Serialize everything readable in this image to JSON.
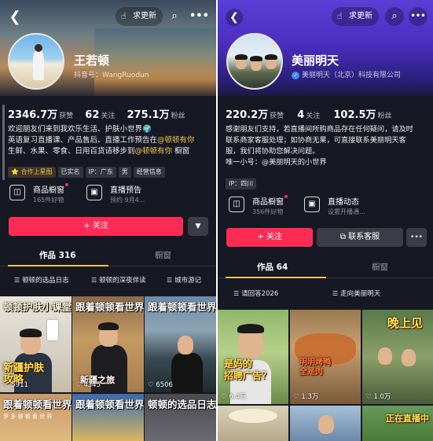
{
  "left": {
    "more_button": "求更新",
    "name": "王若顿",
    "account_id": "抖音号：WangRuodun",
    "stats": [
      {
        "value": "2346.7万",
        "label": "获赞"
      },
      {
        "value": "62",
        "label": "关注"
      },
      {
        "value": "275.1万",
        "label": "粉丝"
      }
    ],
    "bio": {
      "line1": "欢迎朋友们来到我欢乐生活、护肤小世界🌍",
      "line2a": "英语复习直播课、产品售后、直播工作预告在",
      "line2b": "@顿顿有你",
      "line3a": "生鲜、水果、零食、日用百货请移步到",
      "line3b": "@顿顿有你",
      "line3c": "橱窗"
    },
    "tags": [
      "合作上星图",
      "已实名",
      "IP：广东",
      "男",
      "settings-tag"
    ],
    "tag_labels": [
      "⭐ 合作上星图",
      "已实名",
      "IP：广东",
      "男",
      "经营信息"
    ],
    "features": [
      {
        "title": "商品橱窗",
        "sub": "165件好物"
      },
      {
        "title": "直播预告",
        "sub": "预约 9月4..."
      }
    ],
    "follow_button": "+ 关注",
    "tabs": [
      "作品 316",
      "橱窗"
    ],
    "chips": [
      "顿顿的选品日志",
      "顿顿的深夜伴读",
      "城市游记"
    ],
    "tiles": [
      {
        "title": "顿顿护肤小课堂",
        "big": "新疆护肤\n攻略",
        "count": "5911"
      },
      {
        "title": "跟着顿顿看世界",
        "big": "新疆之旅",
        "count": "4345"
      },
      {
        "title": "跟着顿顿看世界",
        "big": "",
        "count": "6506"
      },
      {
        "title": "跟着顿顿看世界",
        "big": "",
        "count": ""
      },
      {
        "title": "跟着顿顿看世界",
        "big": "",
        "count": ""
      },
      {
        "title": "顿顿的选品日志",
        "big": "",
        "count": ""
      }
    ]
  },
  "right": {
    "more_button": "求更新",
    "name": "美丽明天",
    "company": "美丽明天（北京）科技有限公司",
    "stats": [
      {
        "value": "220.2万",
        "label": "获赞"
      },
      {
        "value": "4",
        "label": "关注"
      },
      {
        "value": "102.5万",
        "label": "粉丝"
      }
    ],
    "bio": {
      "line1": "感谢朋友们支持，若直播间所购商品存在任何疑问，请及时",
      "line2": "联系商家客服处理；如协商无果，可直接联系美丽明天客",
      "line3": "服，我们将协助您解决问题。",
      "line4": "唯一小号：@美丽明天的小世界"
    },
    "tag_labels": [
      "IP：四川"
    ],
    "features": [
      {
        "title": "商品橱窗",
        "sub": "356件好物"
      },
      {
        "title": "直播动态",
        "sub": "设置开播通..."
      }
    ],
    "follow_button": "+ 关注",
    "service_button": "联系客服",
    "tabs": [
      "作品 64",
      "橱窗"
    ],
    "chips": [
      "请回答2026",
      "走向美丽明天"
    ],
    "tiles": [
      {
        "big": "是妈的\n招聘广告？",
        "count": "6.4万"
      },
      {
        "big": "明明烤鸭\n全是肉",
        "count": "1.3万"
      },
      {
        "big": "晚上见",
        "count": "1.0万"
      },
      {
        "big": "",
        "count": ""
      },
      {
        "big": "",
        "count": ""
      },
      {
        "big": "正在直播中",
        "count": ""
      }
    ]
  },
  "colors": {
    "accent": "#fe2c55",
    "highlight": "#f0c34c",
    "bg": "#161823"
  }
}
